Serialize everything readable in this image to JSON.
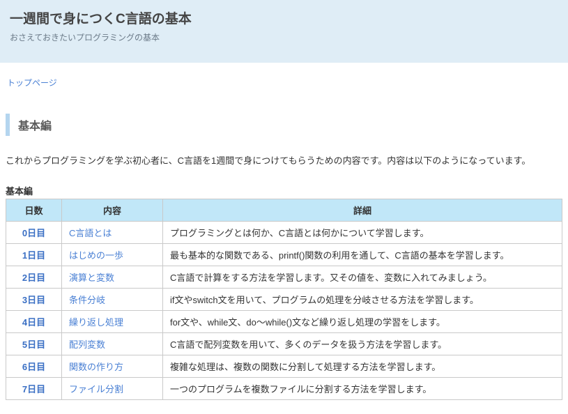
{
  "header": {
    "title": "一週間で身につくC言語の基本",
    "subtitle": "おさえておきたいプログラミングの基本"
  },
  "breadcrumb": {
    "top_label": "トップページ"
  },
  "section": {
    "title": "基本編",
    "intro": "これからプログラミングを学ぶ初心者に、C言語を1週間で身につけてもらうための内容です。内容は以下のようになっています。"
  },
  "table": {
    "caption": "基本編",
    "headers": {
      "day": "日数",
      "topic": "内容",
      "detail": "詳細"
    },
    "rows": [
      {
        "day": "0日目",
        "topic": "C言語とは",
        "detail": "プログラミングとは何か、C言語とは何かについて学習します。"
      },
      {
        "day": "1日目",
        "topic": "はじめの一歩",
        "detail": "最も基本的な関数である、printf()関数の利用を通して、C言語の基本を学習します。"
      },
      {
        "day": "2日目",
        "topic": "演算と変数",
        "detail": "C言語で計算をする方法を学習します。又その値を、変数に入れてみましょう。"
      },
      {
        "day": "3日目",
        "topic": "条件分岐",
        "detail": "if文やswitch文を用いて、プログラムの処理を分岐させる方法を学習します。"
      },
      {
        "day": "4日目",
        "topic": "繰り返し処理",
        "detail": "for文や、while文、do～while()文など繰り返し処理の学習をします。"
      },
      {
        "day": "5日目",
        "topic": "配列変数",
        "detail": "C言語で配列変数を用いて、多くのデータを扱う方法を学習します。"
      },
      {
        "day": "6日目",
        "topic": "関数の作り方",
        "detail": "複雑な処理は、複数の関数に分割して処理する方法を学習します。"
      },
      {
        "day": "7日目",
        "topic": "ファイル分割",
        "detail": "一つのプログラムを複数ファイルに分割する方法を学習します。"
      }
    ]
  }
}
